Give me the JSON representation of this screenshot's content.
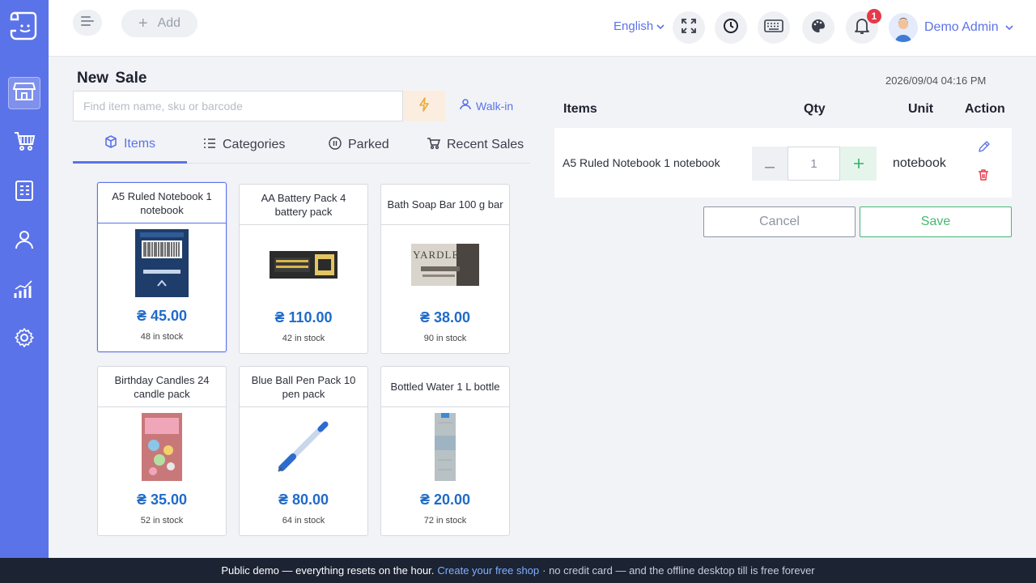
{
  "topbar": {
    "add_label": "Add",
    "language": "English",
    "notification_count": "1",
    "user_name": "Demo Admin"
  },
  "sidebar": {
    "items": [
      {
        "icon": "store-icon",
        "active": true
      },
      {
        "icon": "cart-icon",
        "active": false
      },
      {
        "icon": "clipboard-list-icon",
        "active": false
      },
      {
        "icon": "user-icon",
        "active": false
      },
      {
        "icon": "bar-chart-icon",
        "active": false
      },
      {
        "icon": "gear-icon",
        "active": false
      }
    ]
  },
  "sale": {
    "title": "New  Sale",
    "search_placeholder": "Find item name, sku or barcode",
    "customer": "Walk-in",
    "datetime": "2026/09/04 04:16 PM"
  },
  "tabs": [
    {
      "label": "Items",
      "icon": "cube-icon",
      "active": true
    },
    {
      "label": "Categories",
      "icon": "list-icon",
      "active": false
    },
    {
      "label": "Parked",
      "icon": "pause-icon",
      "active": false
    },
    {
      "label": "Recent Sales",
      "icon": "cart-icon",
      "active": false
    }
  ],
  "products": [
    {
      "name": "A5 Ruled Notebook 1 notebook",
      "price": "₴ 45.00",
      "stock": "48 in stock",
      "image": "notebook"
    },
    {
      "name": "AA Battery Pack 4 battery pack",
      "price": "₴ 110.00",
      "stock": "42 in stock",
      "image": "battery"
    },
    {
      "name": "Bath Soap Bar 100 g bar",
      "price": "₴ 38.00",
      "stock": "90 in stock",
      "image": "soap",
      "image_text": "YARDLEY"
    },
    {
      "name": "Birthday Candles 24 candle pack",
      "price": "₴ 35.00",
      "stock": "52 in stock",
      "image": "candles"
    },
    {
      "name": "Blue Ball Pen Pack 10 pen pack",
      "price": "₴ 80.00",
      "stock": "64 in stock",
      "image": "pen"
    },
    {
      "name": "Bottled Water 1 L bottle",
      "price": "₴ 20.00",
      "stock": "72 in stock",
      "image": "water"
    }
  ],
  "cart": {
    "headers": {
      "items": "Items",
      "qty": "Qty",
      "unit": "Unit",
      "action": "Action"
    },
    "rows": [
      {
        "item": "A5 Ruled Notebook 1 notebook",
        "qty": "1",
        "unit": "notebook"
      }
    ],
    "cancel_label": "Cancel",
    "save_label": "Save"
  },
  "footer": {
    "text1": "Public demo — everything resets on the hour.",
    "link": "Create your free shop",
    "text2": "· no credit card — and the offline desktop till is free forever"
  },
  "colors": {
    "accent": "#5b73e8",
    "price": "#1f6bc9",
    "save": "#46b874",
    "danger": "#e6394a"
  }
}
